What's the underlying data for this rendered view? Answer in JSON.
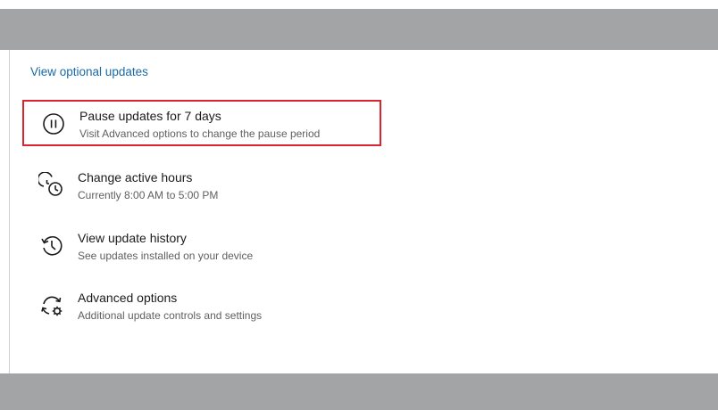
{
  "optional_updates_link": "View optional updates",
  "items": [
    {
      "title": "Pause updates for 7 days",
      "subtitle": "Visit Advanced options to change the pause period",
      "icon": "pause-icon"
    },
    {
      "title": "Change active hours",
      "subtitle": "Currently 8:00 AM to 5:00 PM",
      "icon": "active-hours-icon"
    },
    {
      "title": "View update history",
      "subtitle": "See updates installed on your device",
      "icon": "history-icon"
    },
    {
      "title": "Advanced options",
      "subtitle": "Additional update controls and settings",
      "icon": "advanced-options-icon"
    }
  ],
  "colors": {
    "link": "#1a6aa8",
    "highlight_border": "#d9252b",
    "band": "#a3a4a6"
  }
}
